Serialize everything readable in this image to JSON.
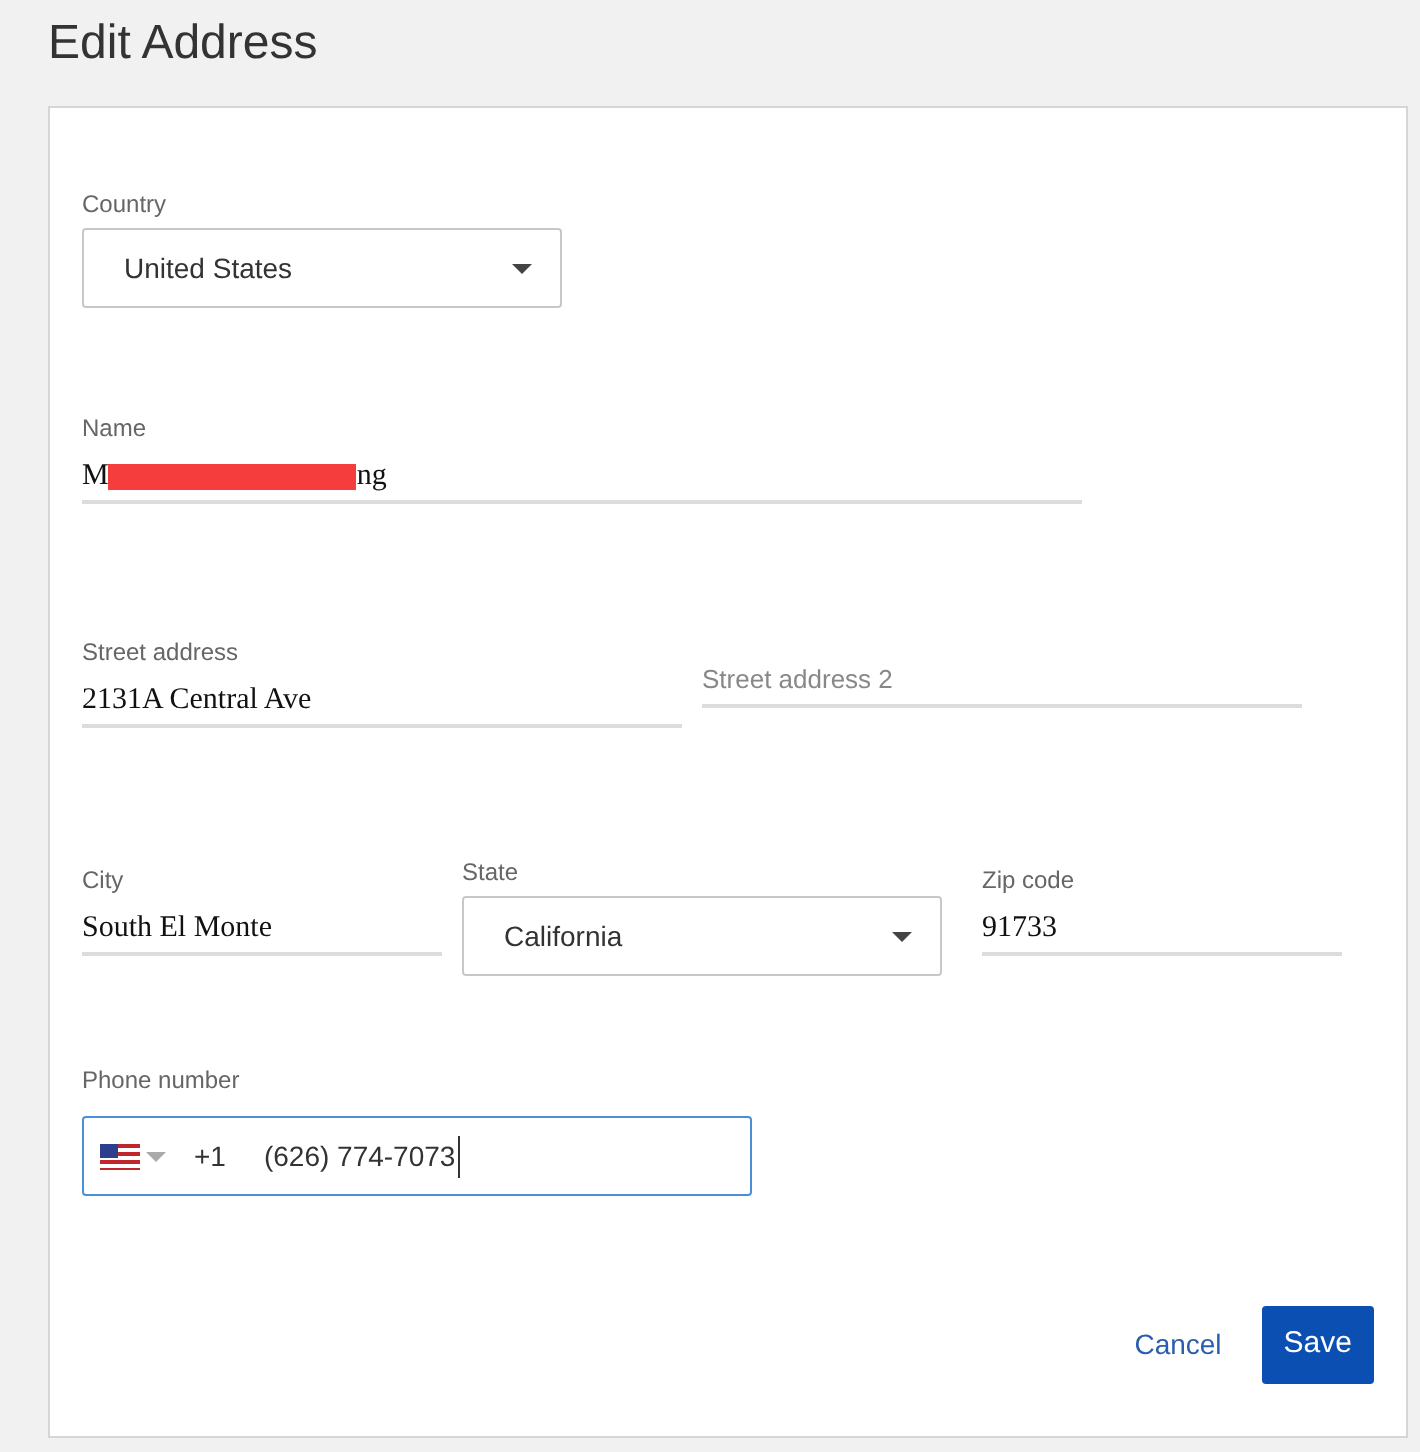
{
  "page_title": "Edit Address",
  "country": {
    "label": "Country",
    "value": "United States"
  },
  "name": {
    "label": "Name",
    "value_start": "M",
    "redacted": true,
    "value_end": "ng"
  },
  "street": {
    "label": "Street address",
    "value": "2131A Central Ave"
  },
  "street2": {
    "placeholder": "Street address 2"
  },
  "city": {
    "label": "City",
    "value": "South El Monte"
  },
  "state": {
    "label": "State",
    "value": "California"
  },
  "zip": {
    "label": "Zip code",
    "value": "91733"
  },
  "phone": {
    "label": "Phone number",
    "dial_code": "+1",
    "value": "(626) 774-7073",
    "focused": true
  },
  "buttons": [
    {
      "label": "Cancel",
      "kind": "text"
    },
    {
      "label": "Save",
      "kind": "primary"
    }
  ]
}
